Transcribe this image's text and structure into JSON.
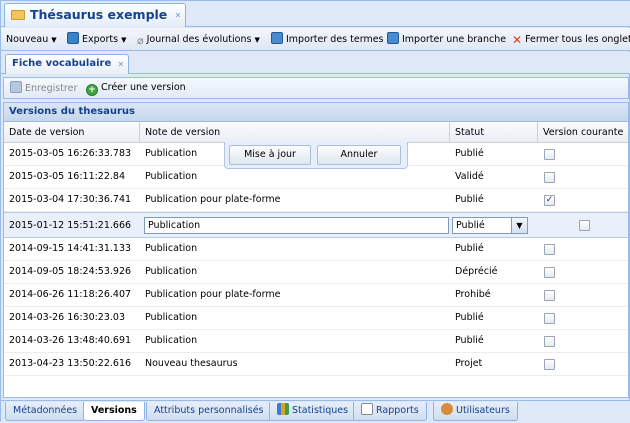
{
  "window": {
    "tab_title": "Thésaurus exemple",
    "close_glyph": "✕"
  },
  "toolbar": {
    "nouveau": "Nouveau",
    "exports": "Exports",
    "journal": "Journal des évolutions",
    "importer_termes": "Importer des termes",
    "importer_branche": "Importer une branche",
    "fermer_onglets": "Fermer tous les onglets"
  },
  "inner_tab": {
    "label": "Fiche vocabulaire"
  },
  "actions": {
    "enregistrer": "Enregistrer",
    "creer_version": "Créer une version"
  },
  "panel": {
    "title": "Versions du thesaurus",
    "columns": [
      "Date de version",
      "Note de version",
      "Statut",
      "Version courante"
    ],
    "rows_before": [
      {
        "date": "2015-03-05 16:26:33.783",
        "note": "Publication",
        "statut": "Publié",
        "courante": false
      },
      {
        "date": "2015-03-05 16:11:22.84",
        "note": "Publication",
        "statut": "Validé",
        "courante": false
      },
      {
        "date": "2015-03-04 17:30:36.741",
        "note": "Publication pour plate-forme",
        "statut": "Publié",
        "courante": true
      }
    ],
    "edit_row": {
      "date": "2015-01-12 15:51:21.666",
      "note": "Publication",
      "statut": "Publié",
      "courante": false
    },
    "rows_after": [
      {
        "date": "2014-09-15 14:41:31.133",
        "note": "Publication",
        "statut": "Publié",
        "courante": false
      },
      {
        "date": "2014-09-05 18:24:53.926",
        "note": "Publication",
        "statut": "Déprécié",
        "courante": false
      },
      {
        "date": "2014-06-26 11:18:26.407",
        "note": "Publication pour plate-forme",
        "statut": "Prohibé",
        "courante": false
      },
      {
        "date": "2014-03-26 16:30:23.03",
        "note": "Publication",
        "statut": "Publié",
        "courante": false
      },
      {
        "date": "2014-03-26 13:48:40.691",
        "note": "Publication",
        "statut": "Publié",
        "courante": false
      },
      {
        "date": "2013-04-23 13:50:22.616",
        "note": "Nouveau thesaurus",
        "statut": "Projet",
        "courante": false
      }
    ],
    "edit_buttons": {
      "update": "Mise à jour",
      "cancel": "Annuler"
    }
  },
  "bottom_tabs": [
    "Métadonnées",
    "Versions",
    "Attributs personnalisés",
    "Statistiques",
    "Rapports",
    "Utilisateurs"
  ]
}
